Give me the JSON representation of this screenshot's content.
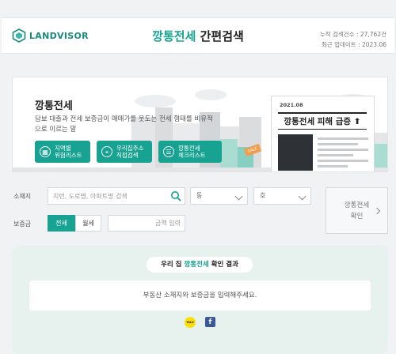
{
  "header": {
    "logo_text": "LANDVISOR",
    "title_accent": "깡통전세",
    "title_rest": " 간편검색",
    "stats_total": "누적 검색건수 : 27,762건",
    "stats_updated": "최근 업데이트 : 2023.06"
  },
  "banner": {
    "title": "깡통전세",
    "description": "담보 대출과 전세 보증금이 매매가를 웃도는 전세 형태를 비유적으로 이르는 말",
    "buttons": [
      {
        "label": "지역별\n위험리스트",
        "icon": "building-icon"
      },
      {
        "label": "우리집주소\n직접검색",
        "icon": "location-pin-icon"
      },
      {
        "label": "깡통전세\n체크리스트",
        "icon": "checklist-icon"
      }
    ],
    "news_date": "2021.08",
    "news_headline": "깡통전세 피해 급증 ⬆",
    "sale_tag": "SALE"
  },
  "form": {
    "location_label": "소재지",
    "search_placeholder": "지번, 도로명, 아파트명 검색",
    "dong_select": "동",
    "ho_select": "호",
    "deposit_label": "보증금",
    "tab_jeonse": "전세",
    "tab_wolse": "월세",
    "amount_placeholder": "금액 입력",
    "check_button_line1": "깡통전세",
    "check_button_line2": "확인"
  },
  "result": {
    "title_prefix": "우리 집 ",
    "title_accent": "깡통전세",
    "title_suffix": " 확인 결과",
    "message": "부동산 소재지와 보증금을 입력해주세요.",
    "kakao_label": "TALK",
    "facebook_label": "f"
  },
  "colors": {
    "accent": "#17a291",
    "result_bg": "#e7f2ef"
  }
}
